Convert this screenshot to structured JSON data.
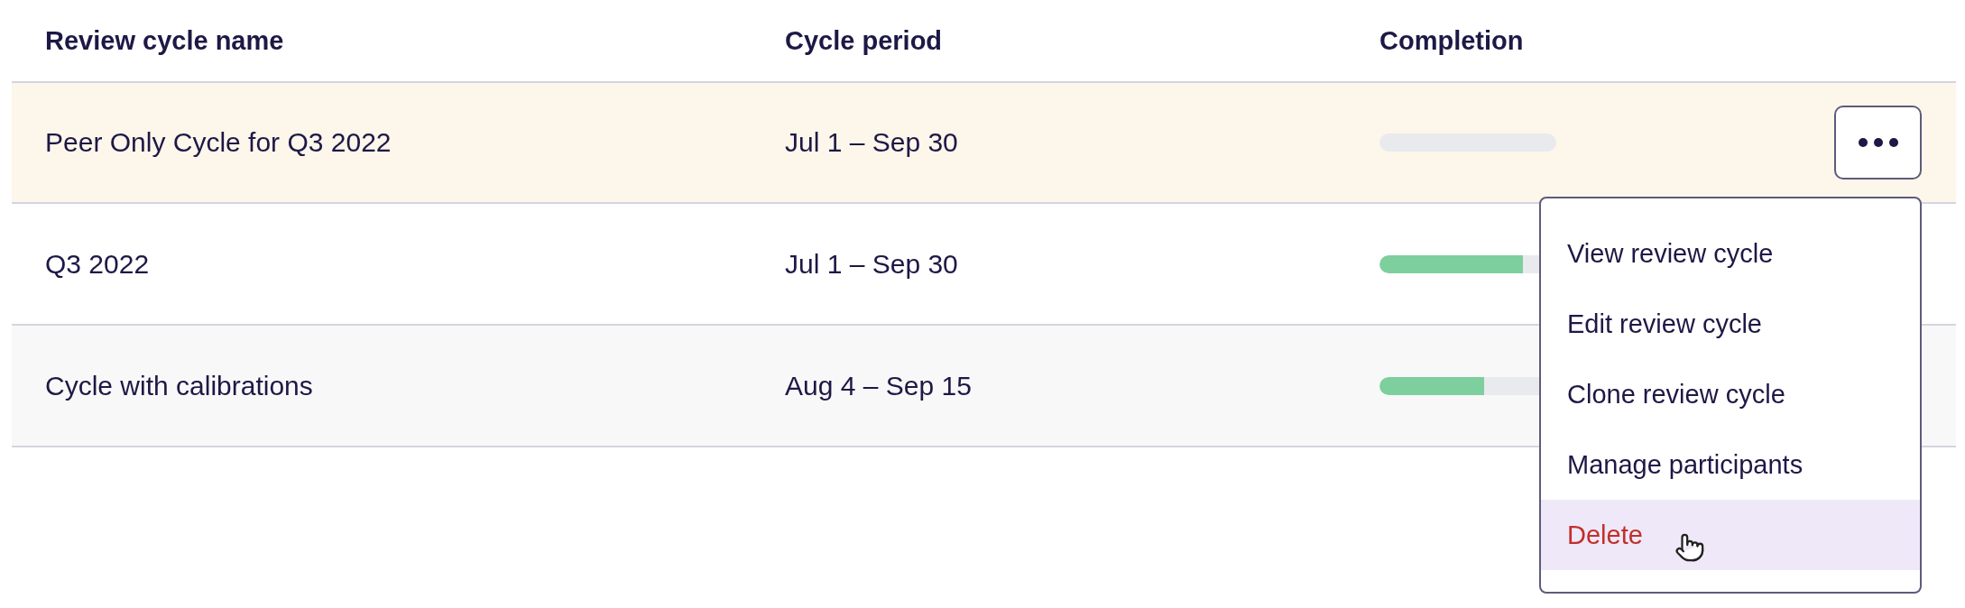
{
  "table": {
    "columns": [
      "Review cycle name",
      "Cycle period",
      "Completion"
    ],
    "rows": [
      {
        "name": "Peer Only Cycle for Q3 2022",
        "period": "Jul 1 – Sep 30",
        "kind": "active",
        "menu_open": true
      },
      {
        "name": "Q3 2022",
        "period": "Jul 1 – Sep 30",
        "level": 0.81,
        "kind": "plain",
        "menu_open": false
      },
      {
        "name": "Cycle with calibrations",
        "period": "Aug 4 – Sep 15",
        "level": 0.59,
        "kind": "shaded",
        "menu_open": false
      }
    ]
  },
  "menu": {
    "items": [
      {
        "label": "View review cycle",
        "kind": "normal",
        "selected": false
      },
      {
        "label": "Edit review cycle",
        "kind": "normal",
        "selected": false
      },
      {
        "label": "Clone review cycle",
        "kind": "normal",
        "selected": false
      },
      {
        "label": "Manage participants",
        "kind": "normal",
        "selected": false
      },
      {
        "label": "Delete",
        "kind": "danger",
        "selected": true
      }
    ]
  }
}
